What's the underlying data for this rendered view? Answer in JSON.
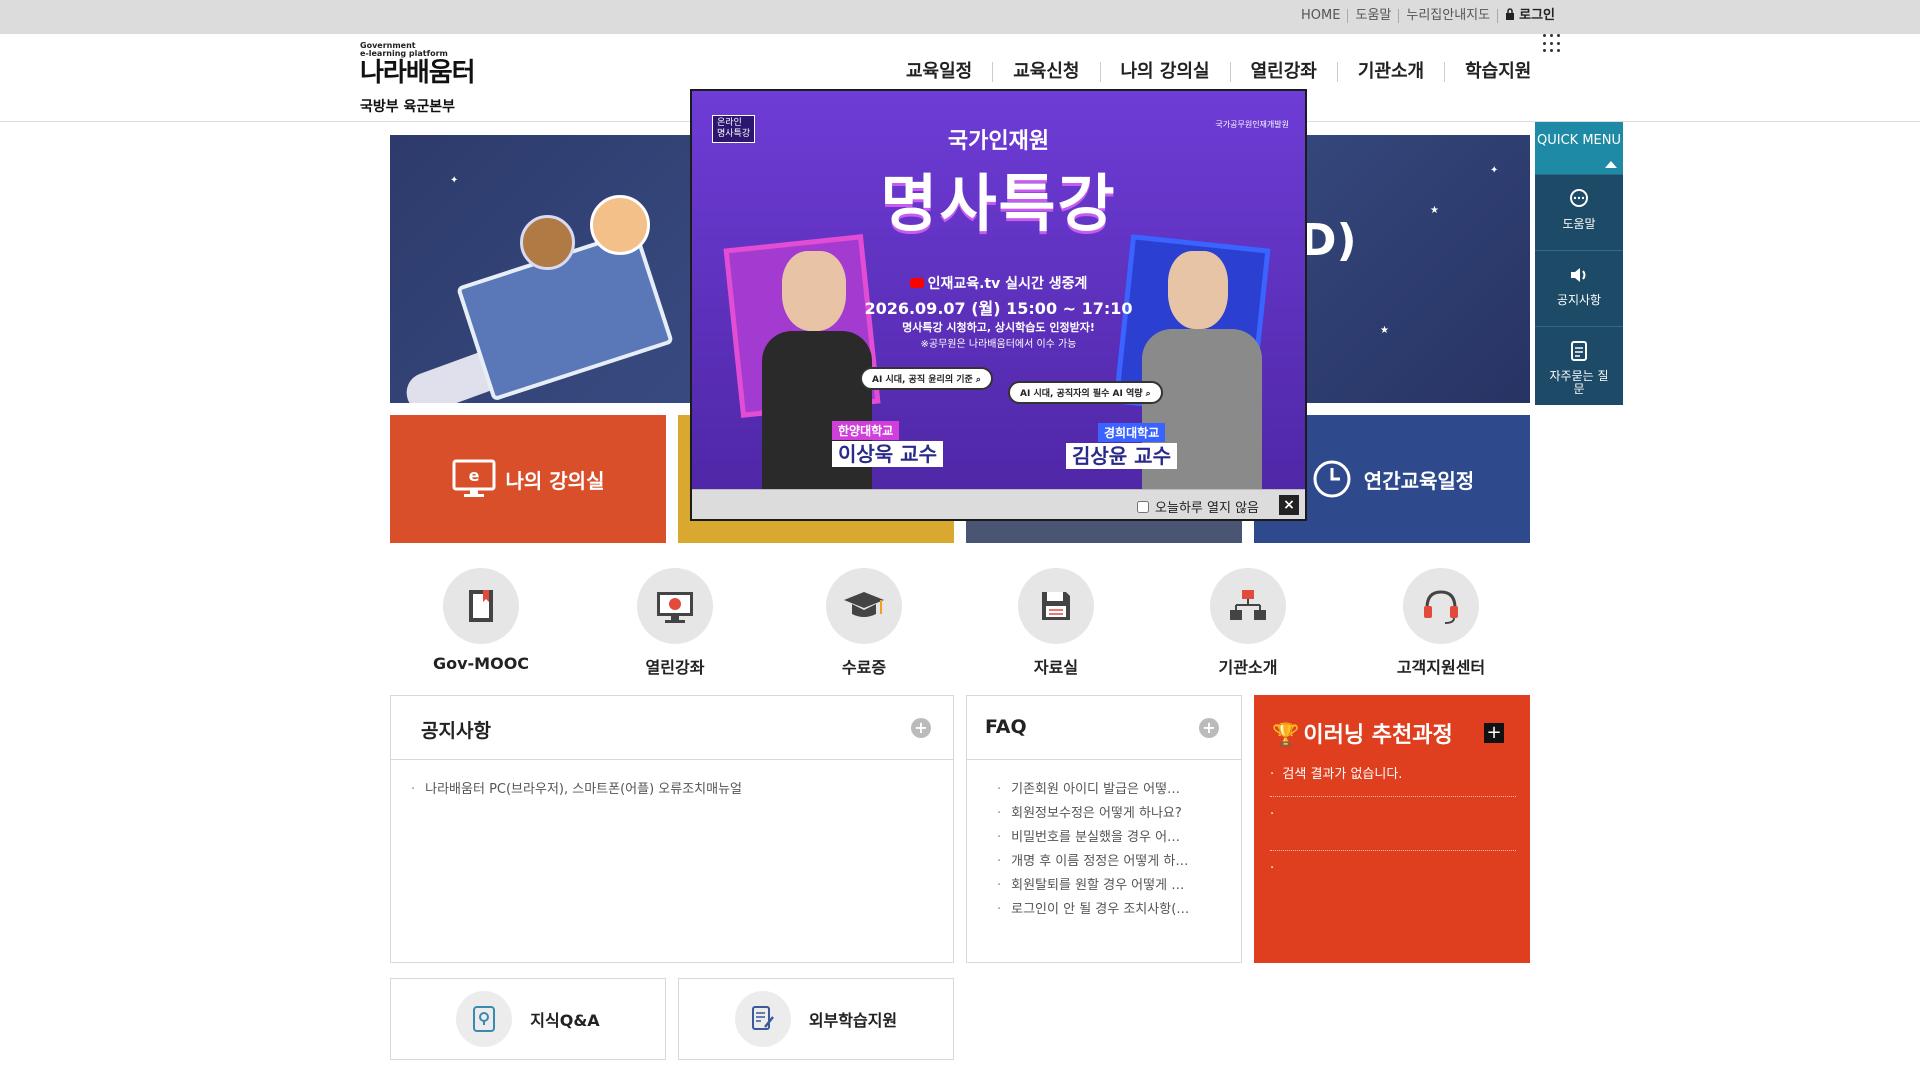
{
  "util": {
    "links": [
      "HOME",
      "도움말",
      "누리집안내지도",
      "로그인"
    ]
  },
  "logo": {
    "small1": "Government",
    "small2": "e-learning platform",
    "title": "나라배움터",
    "org": "국방부 육군본부"
  },
  "gnb": [
    "교육일정",
    "교육신청",
    "나의 강의실",
    "열린강좌",
    "기관소개",
    "학습지원"
  ],
  "banner": {
    "partial_text": "D)"
  },
  "tiles": [
    "나의 강의실",
    "연간교육일정"
  ],
  "quick": {
    "title": "QUICK MENU",
    "items": [
      "도움말",
      "공지사항",
      "자주묻는 질문"
    ]
  },
  "shortcuts": [
    "Gov-MOOC",
    "열린강좌",
    "수료증",
    "자료실",
    "기관소개",
    "고객지원센터"
  ],
  "notice": {
    "title": "공지사항",
    "items": [
      "나라배움터 PC(브라우저), 스마트폰(어플) 오류조치매뉴얼"
    ]
  },
  "faq": {
    "title": "FAQ",
    "items": [
      "기존회원 아이디 발급은 어떻…",
      "회원정보수정은 어떻게 하나요?",
      "비밀번호를 분실했을 경우 어…",
      "개명 후 이름 정정은 어떻게 하…",
      "회원탈퇴를 원할 경우 어떻게 …",
      "로그인이 안 될 경우 조치사항(…"
    ]
  },
  "recommend": {
    "title": "이러닝 추천과정",
    "items": [
      "검색 결과가 없습니다.",
      "",
      ""
    ]
  },
  "bottom_buttons": [
    "지식Q&A",
    "외부학습지원"
  ],
  "popup": {
    "badge1": "온라인",
    "badge2": "명사특강",
    "org": "국가공무원인재개발원",
    "title1": "국가인재원",
    "title2": "명사특강",
    "live": "인재교육.tv 실시간 생중계",
    "date": "2026.09.07 (월) 15:00 ~ 17:10",
    "line1": "명사특강 시청하고, 상시학습도 인정받자!",
    "line2": "※공무원은 나라배움터에서 이수 가능",
    "topic1": "AI 시대, 공직 윤리의 기준",
    "topic2": "AI 시대, 공직자의 필수 AI 역량",
    "univ1": "한양대학교",
    "prof1": "이상욱 교수",
    "univ2": "경희대학교",
    "prof2": "김상윤 교수",
    "dont_show": "오늘하루 열지 않음",
    "close_icon": "×"
  },
  "colors": {
    "tile_orange": "#d84f2a",
    "tile_yellow": "#d9a82f",
    "tile_slate": "#4a5573",
    "tile_blue": "#2e4a8c",
    "recommend_red": "#df3f1f",
    "quick_bg": "#1d4a66"
  }
}
